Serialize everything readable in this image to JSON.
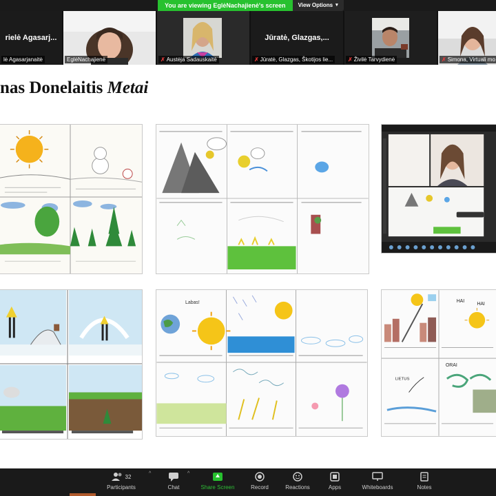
{
  "banner": {
    "text": "You are viewing EglėNachajienė's screen",
    "options_label": "View Options"
  },
  "participants": [
    {
      "big_name": "rielė Agasarj...",
      "label": "lė Agasarjanaitė",
      "muted": false
    },
    {
      "big_name": "",
      "label": "EglėNachajienė",
      "muted": false
    },
    {
      "big_name": "",
      "label": "Austėja Sadauskaitė",
      "muted": true
    },
    {
      "big_name": "Jūratė, Glazgas,...",
      "label": "Jūratė, Glazgas, Škotijos lie...",
      "muted": true
    },
    {
      "big_name": "",
      "label": "Živilė Tarvydienė",
      "muted": true
    },
    {
      "big_name": "",
      "label": "Simona, Virtuali mo",
      "muted": true
    }
  ],
  "slide": {
    "title_normal": "nas Donelaitis ",
    "title_italic": "Metai"
  },
  "toolbar": {
    "participants_label": "Participants",
    "participants_count": "32",
    "chat_label": "Chat",
    "share_label": "Share Screen",
    "record_label": "Record",
    "reactions_label": "Reactions",
    "apps_label": "Apps",
    "whiteboards_label": "Whiteboards",
    "notes_label": "Notes"
  },
  "drawing_texts": {
    "panel4_top_left": "Labas!",
    "panel6_hi": "HAI",
    "panel6_hai": "HAI",
    "panel6_orai": "ORAI",
    "panel6_lietus": "LIETUS"
  },
  "colors": {
    "share_green": "#27c12f",
    "muted_red": "#e03a3a",
    "toolbar_bg": "#1a1a1a"
  }
}
